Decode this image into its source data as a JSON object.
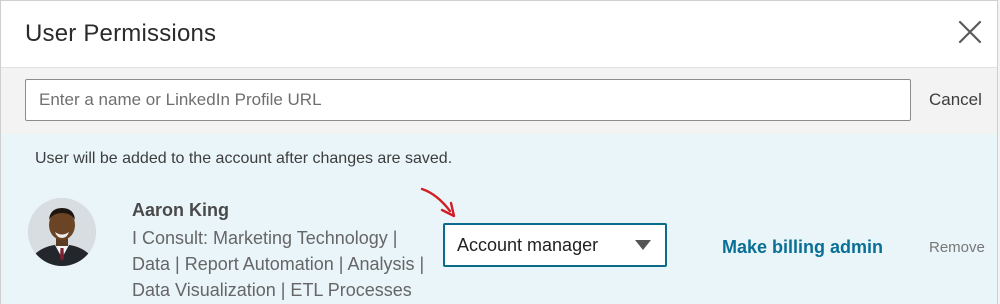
{
  "dialog": {
    "title": "User Permissions",
    "close_icon": "close-icon"
  },
  "search": {
    "placeholder": "Enter a name or LinkedIn Profile URL",
    "value": "",
    "cancel_label": "Cancel"
  },
  "notice": "User will be added to the account after changes are saved.",
  "user": {
    "name": "Aaron King",
    "headline": "I Consult: Marketing Technology | Data | Report Automation | Analysis | Data Visualization | ETL Processes",
    "avatar_icon": "avatar"
  },
  "role": {
    "selected": "Account manager",
    "chevron_icon": "chevron-down-icon"
  },
  "actions": {
    "billing_label": "Make billing admin",
    "remove_label": "Remove"
  },
  "colors": {
    "accent": "#0a6f95",
    "select_border": "#0a6b8a",
    "content_bg": "#e9f5f9",
    "annotation_arrow": "#d11f25"
  }
}
